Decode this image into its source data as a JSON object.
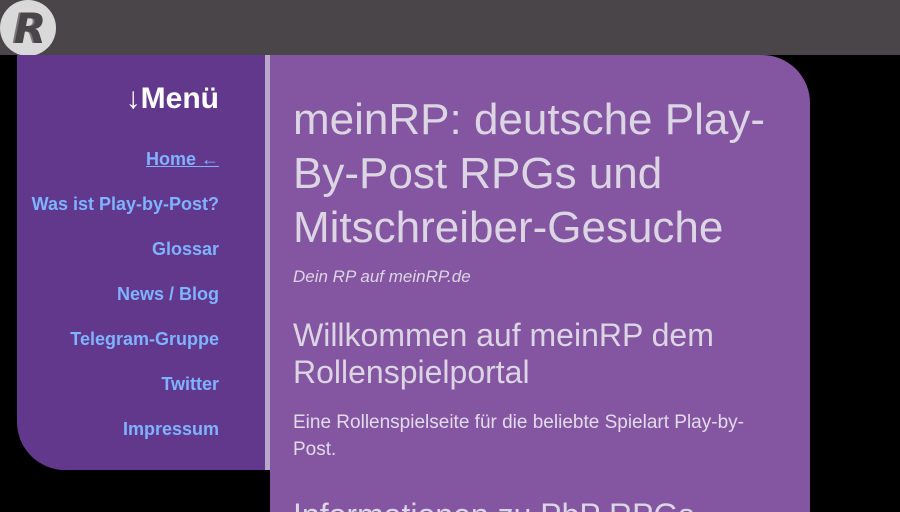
{
  "logo": {
    "letter": "R",
    "icon": "meinrp-logo-icon"
  },
  "sidebar": {
    "title": "↓Menü",
    "items": [
      {
        "label": "Home ←",
        "active": true
      },
      {
        "label": "Was ist Play-by-Post?"
      },
      {
        "label": "Glossar"
      },
      {
        "label": "News / Blog"
      },
      {
        "label": "Telegram-Gruppe"
      },
      {
        "label": "Twitter"
      },
      {
        "label": "Impressum"
      }
    ]
  },
  "main": {
    "title": "meinRP: deutsche Play-By-Post RPGs und Mitschreiber-Gesuche",
    "tagline": "Dein RP auf meinRP.de",
    "welcome_heading": "Willkommen auf meinRP dem Rollenspielportal",
    "intro": "Eine Rollenspielseite für die beliebte Spielart Play-by-Post.",
    "next_heading": "Informationen zu PbP RPGs"
  },
  "colors": {
    "topbar": "#4a4548",
    "sidebar": "#61388c",
    "content": "#8455a0",
    "link": "#7fb2ff",
    "background": "#000000"
  }
}
